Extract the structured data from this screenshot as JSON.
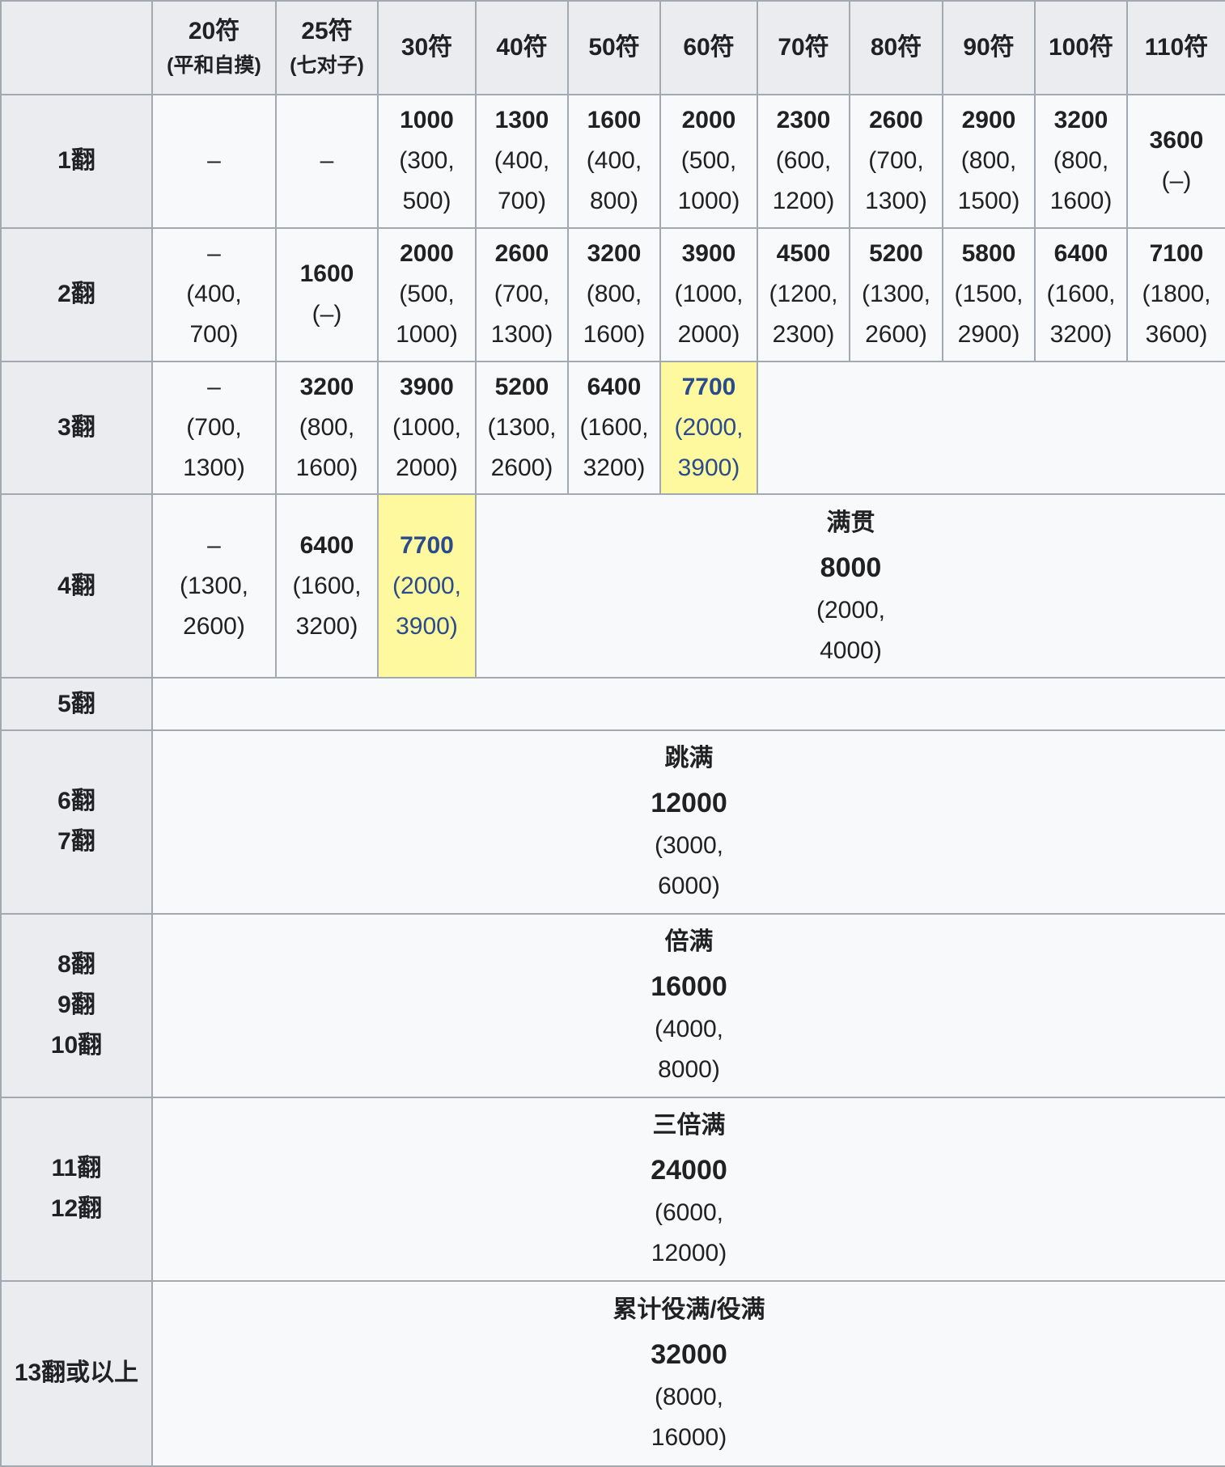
{
  "header": {
    "fu": [
      "20符",
      "25符",
      "30符",
      "40符",
      "50符",
      "60符",
      "70符",
      "80符",
      "90符",
      "100符",
      "110符"
    ],
    "notes": [
      "(平和自摸)",
      "(七对子)"
    ]
  },
  "rows": [
    {
      "han": "1翻",
      "cells": [
        {
          "dash": "–"
        },
        {
          "dash": "–"
        },
        {
          "pts": "1000",
          "a": "(300,",
          "b": "500)"
        },
        {
          "pts": "1300",
          "a": "(400,",
          "b": "700)"
        },
        {
          "pts": "1600",
          "a": "(400,",
          "b": "800)"
        },
        {
          "pts": "2000",
          "a": "(500,",
          "b": "1000)"
        },
        {
          "pts": "2300",
          "a": "(600,",
          "b": "1200)"
        },
        {
          "pts": "2600",
          "a": "(700,",
          "b": "1300)"
        },
        {
          "pts": "2900",
          "a": "(800,",
          "b": "1500)"
        },
        {
          "pts": "3200",
          "a": "(800,",
          "b": "1600)"
        },
        {
          "pts": "3600",
          "a": "(–)"
        }
      ]
    },
    {
      "han": "2翻",
      "cells": [
        {
          "dash": "–",
          "a": "(400,",
          "b": "700)"
        },
        {
          "pts": "1600",
          "a": "(–)"
        },
        {
          "pts": "2000",
          "a": "(500,",
          "b": "1000)"
        },
        {
          "pts": "2600",
          "a": "(700,",
          "b": "1300)"
        },
        {
          "pts": "3200",
          "a": "(800,",
          "b": "1600)"
        },
        {
          "pts": "3900",
          "a": "(1000,",
          "b": "2000)"
        },
        {
          "pts": "4500",
          "a": "(1200,",
          "b": "2300)"
        },
        {
          "pts": "5200",
          "a": "(1300,",
          "b": "2600)"
        },
        {
          "pts": "5800",
          "a": "(1500,",
          "b": "2900)"
        },
        {
          "pts": "6400",
          "a": "(1600,",
          "b": "3200)"
        },
        {
          "pts": "7100",
          "a": "(1800,",
          "b": "3600)"
        }
      ]
    },
    {
      "han": "3翻",
      "cells": [
        {
          "dash": "–",
          "a": "(700,",
          "b": "1300)"
        },
        {
          "pts": "3200",
          "a": "(800,",
          "b": "1600)"
        },
        {
          "pts": "3900",
          "a": "(1000,",
          "b": "2000)"
        },
        {
          "pts": "5200",
          "a": "(1300,",
          "b": "2600)"
        },
        {
          "pts": "6400",
          "a": "(1600,",
          "b": "3200)"
        },
        {
          "pts": "7700",
          "a": "(2000,",
          "b": "3900)",
          "highlight": true
        }
      ]
    },
    {
      "han": "4翻",
      "cells": [
        {
          "dash": "–",
          "a": "(1300,",
          "b": "2600)"
        },
        {
          "pts": "6400",
          "a": "(1600,",
          "b": "3200)"
        },
        {
          "pts": "7700",
          "a": "(2000,",
          "b": "3900)",
          "highlight": true
        }
      ]
    }
  ],
  "mangan": {
    "name": "满贯",
    "pts": "8000",
    "a": "(2000,",
    "b": "4000)"
  },
  "han5": "5翻",
  "limits": [
    {
      "han": [
        "6翻",
        "7翻"
      ],
      "name": "跳满",
      "pts": "12000",
      "a": "(3000,",
      "b": "6000)"
    },
    {
      "han": [
        "8翻",
        "9翻",
        "10翻"
      ],
      "name": "倍满",
      "pts": "16000",
      "a": "(4000,",
      "b": "8000)"
    },
    {
      "han": [
        "11翻",
        "12翻"
      ],
      "name": "三倍满",
      "pts": "24000",
      "a": "(6000,",
      "b": "12000)"
    },
    {
      "han": [
        "13翻或以上"
      ],
      "name": "累计役满/役满",
      "pts": "32000",
      "a": "(8000,",
      "b": "16000)"
    }
  ],
  "colors": {
    "highlight_bg": "#fef99e",
    "highlight_text": "#2a4b8d",
    "header_bg": "#eaecf0",
    "cell_bg": "#f8f9fa",
    "border": "#a2a9b1"
  }
}
